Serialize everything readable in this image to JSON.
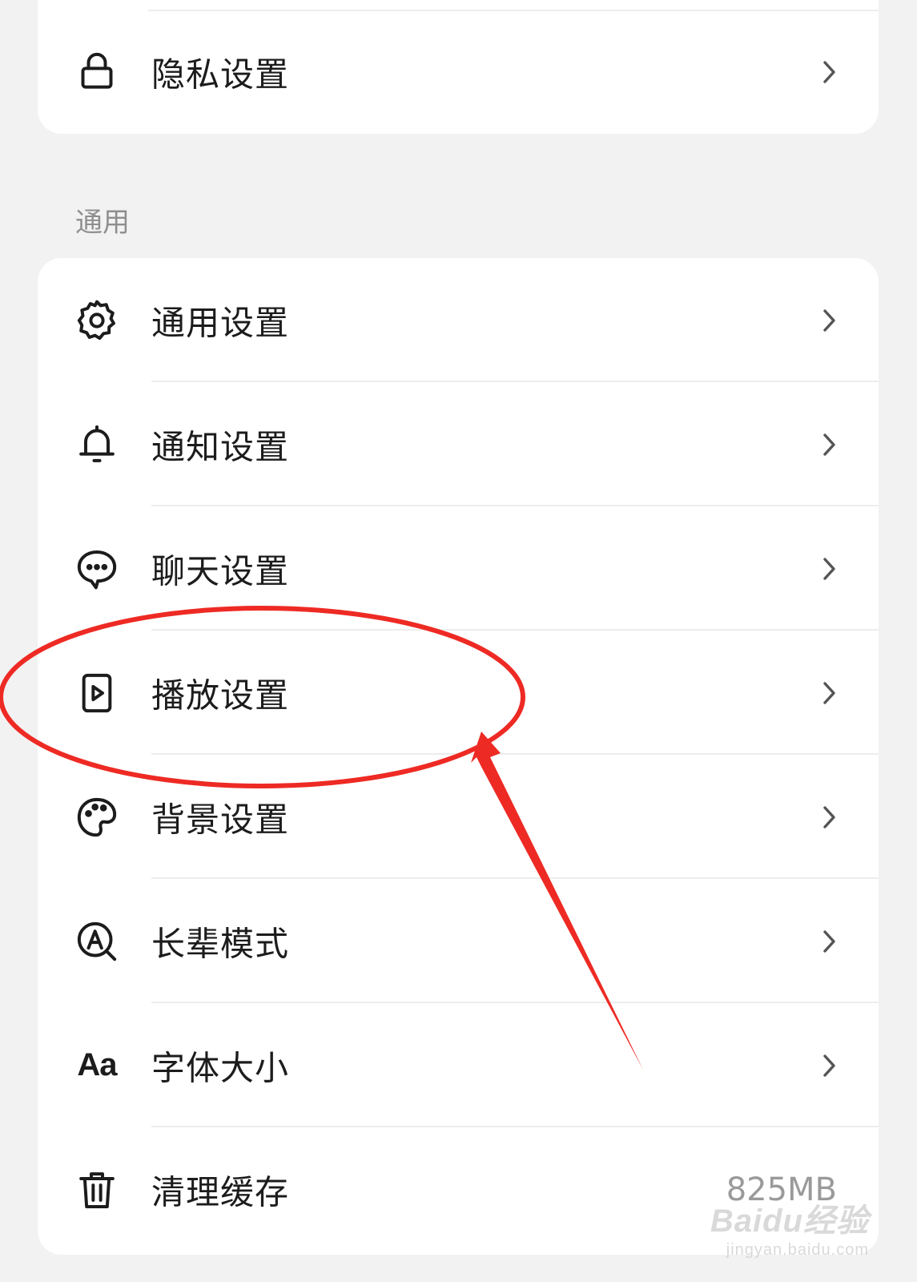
{
  "privacy_group": {
    "items": [
      {
        "label": "隐私设置",
        "icon": "lock-icon"
      }
    ]
  },
  "general_section": {
    "title": "通用",
    "items": [
      {
        "label": "通用设置",
        "icon": "gear-icon"
      },
      {
        "label": "通知设置",
        "icon": "bell-icon"
      },
      {
        "label": "聊天设置",
        "icon": "chat-bubble-icon"
      },
      {
        "label": "播放设置",
        "icon": "play-file-icon"
      },
      {
        "label": "背景设置",
        "icon": "palette-icon"
      },
      {
        "label": "长辈模式",
        "icon": "elder-mode-icon"
      },
      {
        "label": "字体大小",
        "icon": "font-size-icon",
        "glyph": "Aa"
      },
      {
        "label": "清理缓存",
        "icon": "trash-icon",
        "value": "825MB"
      }
    ]
  },
  "annotation": {
    "color": "#ee2a24",
    "highlighted_item": "播放设置"
  },
  "watermark": {
    "main": "Baidu经验",
    "sub": "jingyan.baidu.com"
  }
}
